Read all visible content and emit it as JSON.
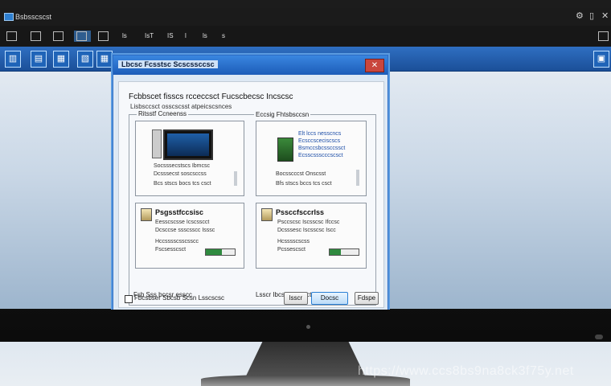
{
  "window": {
    "title": "Bsbsscscst"
  },
  "toolbar": [
    {
      "label": "",
      "active": false
    },
    {
      "label": "",
      "active": false
    },
    {
      "label": "",
      "active": false
    },
    {
      "label": "",
      "active": true
    },
    {
      "label": "ls",
      "active": false
    },
    {
      "label": "IsT",
      "active": false
    },
    {
      "label": "IS",
      "active": false
    },
    {
      "label": "l",
      "active": false
    },
    {
      "label": "ls",
      "active": false
    },
    {
      "label": "s",
      "active": false
    }
  ],
  "dialog": {
    "title": "Lbcsc Fcsstsc Scscssccsc",
    "heading": "Fcbbscet fisscs rcceccsct Fucscbecsc Incscsc",
    "subheading": "Lisbsccsct osscscsst atpeicscsnces",
    "group_left": "Ritsstf Ccneenss",
    "group_right": "Eccsig Fhtsbsccsn",
    "cards": [
      {
        "title": "",
        "lines": [
          "Socsssecstscs Ibmcsc",
          "Dcsssecst soscsccss",
          "Bcs stscs bocs tcs csct"
        ],
        "links": []
      },
      {
        "title": "",
        "lines": [
          "Bocsscccst Onscsst",
          "Bfs stscs bccs tcs csct"
        ],
        "links": [
          "Elt lccs nesscncs",
          "Ecsccsceciscscs",
          "Bsmccsbcssccssct",
          "Ecsscssscccscsct"
        ]
      },
      {
        "title": "Psgsstfccsisc",
        "lines": [
          "Eesscscsse Icscsscct",
          "Dcsccse ssscsscc Isssc",
          "Hccsssscsscsscc",
          "Fscsesscsct"
        ],
        "links": []
      },
      {
        "title": "Pssccfsccrlss",
        "lines": [
          "Psccscsc Iscsscsc Ifccsc",
          "Dcsssesc Iscsscsc Iscc",
          "Hcsssscscss",
          "Pcssescsct"
        ],
        "links": []
      }
    ],
    "footer_left": "Fsb Sss bccsr esscc",
    "footer_right": "Lsscr Ibcs bcsecsct",
    "checkbox_label": "Fbcsbser Sbcsb Scsn Lsscscsc",
    "checkbox_checked": false,
    "buttons": {
      "back": "lsscr",
      "ok": "Docsc",
      "cancel": "Fdspe"
    },
    "progress": [
      0.55,
      0.4
    ]
  },
  "watermark": "https://www.ccs8bs9na8ck3f75y.net"
}
